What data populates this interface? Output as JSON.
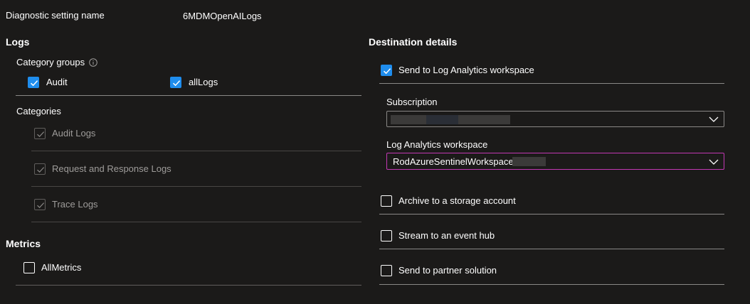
{
  "setting": {
    "name_label": "Diagnostic setting name",
    "name_value": "6MDMOpenAILogs"
  },
  "logs": {
    "heading": "Logs",
    "category_groups_label": "Category groups",
    "groups": [
      {
        "label": "Audit",
        "checked": true
      },
      {
        "label": "allLogs",
        "checked": true
      }
    ],
    "categories_label": "Categories",
    "categories": [
      {
        "label": "Audit Logs",
        "checked": true,
        "disabled": true
      },
      {
        "label": "Request and Response Logs",
        "checked": true,
        "disabled": true
      },
      {
        "label": "Trace Logs",
        "checked": true,
        "disabled": true
      }
    ]
  },
  "metrics": {
    "heading": "Metrics",
    "items": [
      {
        "label": "AllMetrics",
        "checked": false
      }
    ]
  },
  "destination": {
    "heading": "Destination details",
    "log_analytics": {
      "label": "Send to Log Analytics workspace",
      "checked": true
    },
    "subscription_label": "Subscription",
    "workspace_label": "Log Analytics workspace",
    "workspace_value": "RodAzureSentinelWorkspace",
    "options": [
      {
        "label": "Archive to a storage account",
        "checked": false
      },
      {
        "label": "Stream to an event hub",
        "checked": false
      },
      {
        "label": "Send to partner solution",
        "checked": false
      }
    ]
  },
  "colors": {
    "background": "#1b1a19",
    "checkbox_checked": "#1f8ded",
    "focus_border": "#c239b3"
  }
}
